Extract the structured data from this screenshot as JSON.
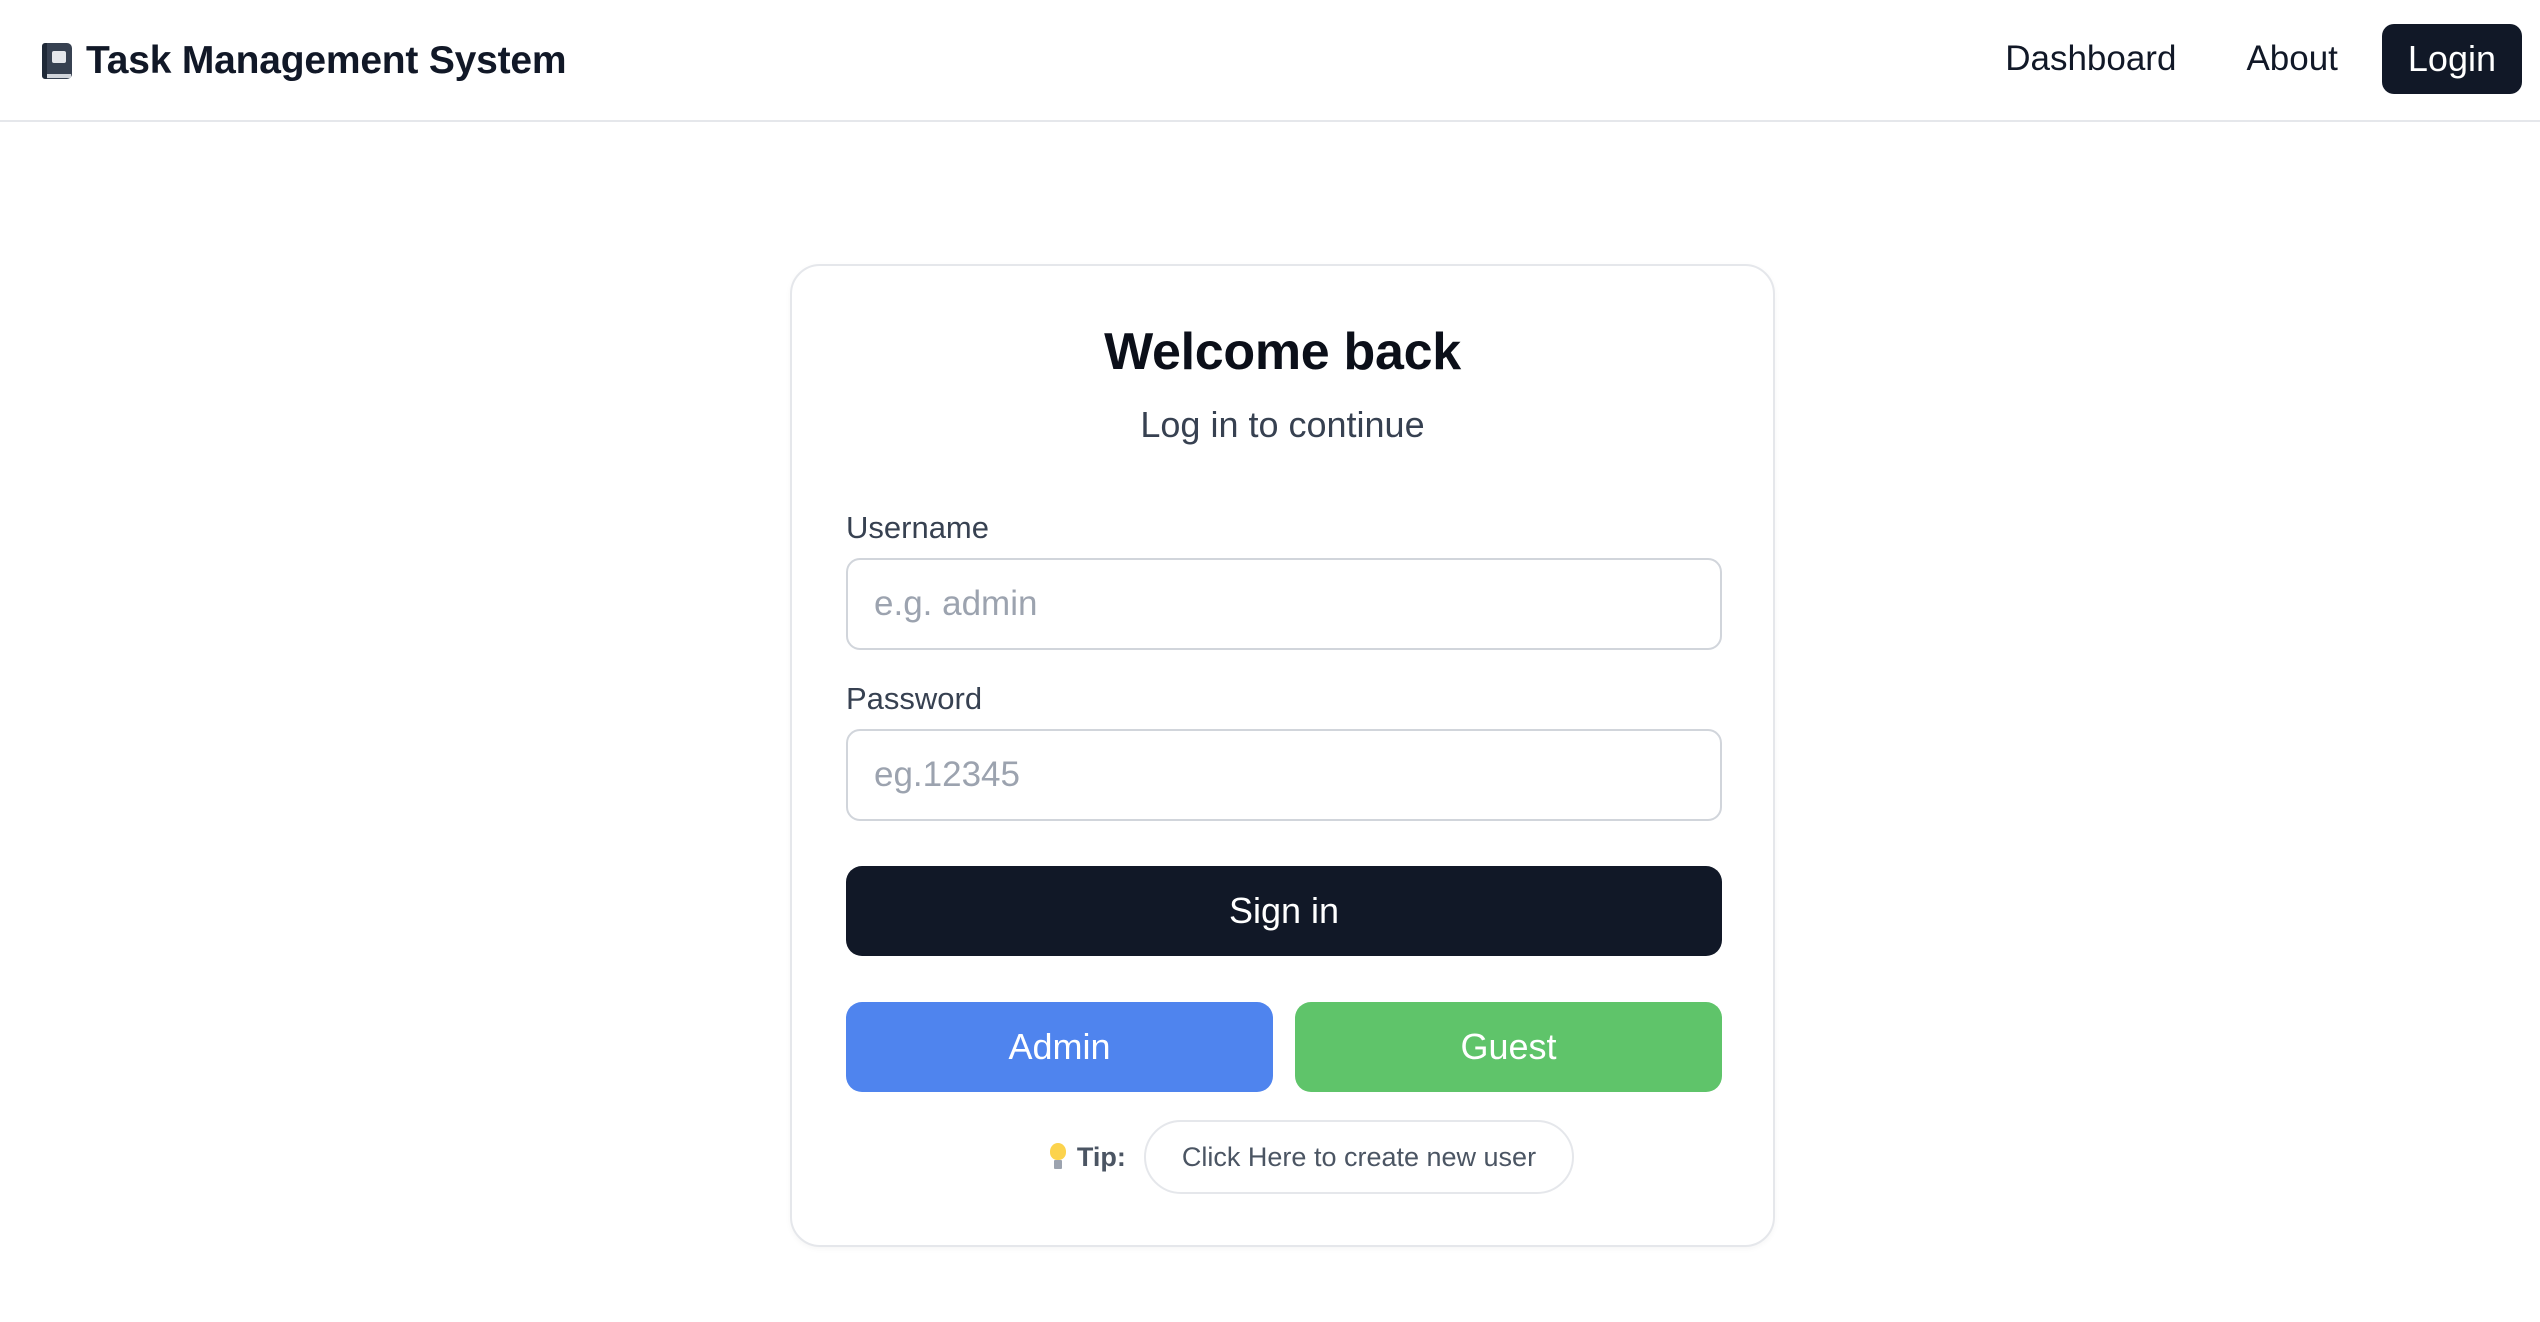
{
  "header": {
    "brand_icon": "notebook-icon",
    "brand_title": "Task Management System",
    "nav": {
      "dashboard_label": "Dashboard",
      "about_label": "About",
      "login_label": "Login"
    }
  },
  "login_card": {
    "title": "Welcome back",
    "subtitle": "Log in to continue",
    "username": {
      "label": "Username",
      "value": "",
      "placeholder": "e.g. admin"
    },
    "password": {
      "label": "Password",
      "value": "",
      "placeholder": "eg.12345"
    },
    "signin_label": "Sign in",
    "admin_label": "Admin",
    "guest_label": "Guest",
    "tip": {
      "icon": "lightbulb-icon",
      "label": "Tip:",
      "link_text": "Click Here to create new user"
    }
  },
  "colors": {
    "primary_dark": "#111827",
    "admin_blue": "#4f84ee",
    "guest_green": "#5fc46a",
    "border": "#e5e7eb"
  }
}
